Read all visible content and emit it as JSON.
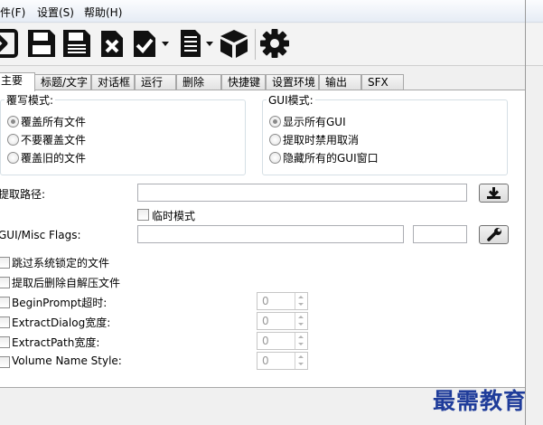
{
  "menu": [
    {
      "label": "文件(F)"
    },
    {
      "label": "设置(S)"
    },
    {
      "label": "帮助(H)"
    }
  ],
  "toolbar": {
    "icons": [
      "next-arrow-icon",
      "save-icon",
      "save-as-icon",
      "delete-icon",
      "check-icon",
      "list-icon",
      "package-icon",
      "gear-icon"
    ]
  },
  "tabs": [
    "主要",
    "标题/文字",
    "对话框",
    "运行",
    "删除",
    "快捷键",
    "设置环境",
    "输出",
    "SFX"
  ],
  "overwrite_group": {
    "title": "覆写模式:",
    "options": [
      "覆盖所有文件",
      "不要覆盖文件",
      "覆盖旧的文件"
    ],
    "selected": 0
  },
  "gui_group": {
    "title": "GUI模式:",
    "options": [
      "显示所有GUI",
      "提取时禁用取消",
      "隐藏所有的GUI窗口"
    ],
    "selected": 0
  },
  "extract_path": {
    "label": "提取路径:",
    "value": ""
  },
  "temp_mode": {
    "label": "临时模式",
    "checked": false
  },
  "gui_flags": {
    "label": "GUI/Misc Flags:",
    "value": "",
    "value2": ""
  },
  "checkboxes": [
    {
      "label": "跳过系统锁定的文件",
      "checked": false
    },
    {
      "label": "提取后删除自解压文件",
      "checked": false
    },
    {
      "label": "BeginPrompt超时:",
      "checked": false,
      "spin": "0"
    },
    {
      "label": "ExtractDialog宽度:",
      "checked": false,
      "spin": "0"
    },
    {
      "label": "ExtractPath宽度:",
      "checked": false,
      "spin": "0"
    },
    {
      "label": "Volume Name Style:",
      "checked": false,
      "spin": "0"
    }
  ],
  "watermark": "最需教育"
}
